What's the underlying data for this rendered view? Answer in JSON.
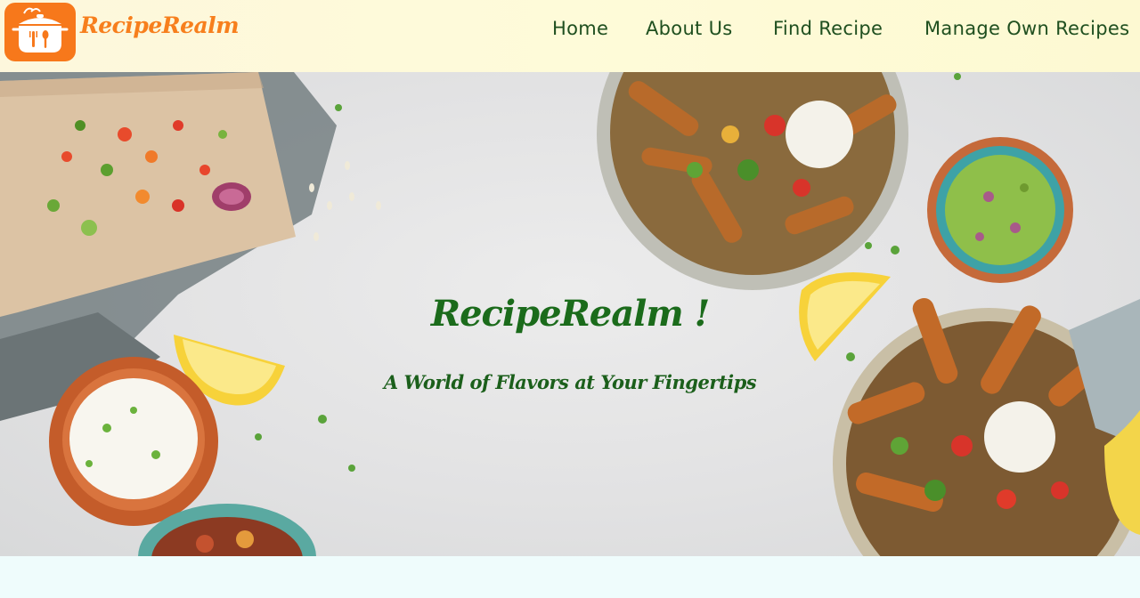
{
  "header": {
    "brand_name": "RecipeRealm",
    "logo_icon": "cooking-pot-icon",
    "brand_color": "#f7781b",
    "nav": [
      {
        "label": "Home"
      },
      {
        "label": "About Us"
      },
      {
        "label": "Find Recipe"
      },
      {
        "label": "Manage Own Recipes"
      }
    ]
  },
  "hero": {
    "title": "RecipeRealm !",
    "subtitle": "A World of Flavors at Your Fingertips",
    "text_color": "#1b6b1b",
    "background_image": "overhead-food-flatlay"
  }
}
